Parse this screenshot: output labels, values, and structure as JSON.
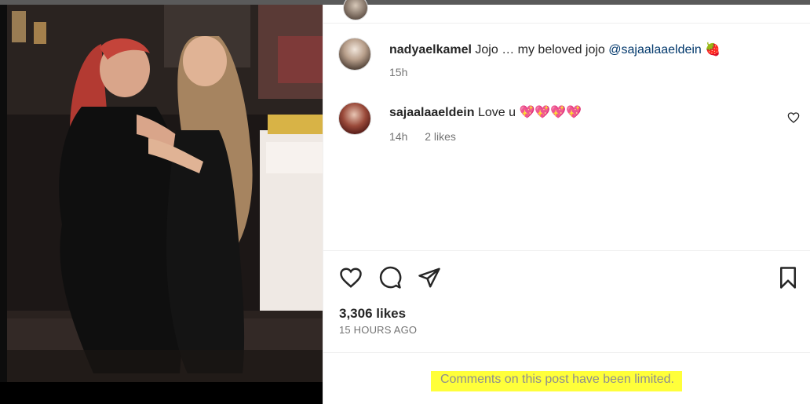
{
  "post": {
    "caption": {
      "username": "nadyaelkamel",
      "text": "Jojo … my beloved jojo",
      "mention": "@sajaalaaeldein",
      "emoji": "🍓",
      "time": "15h"
    },
    "comments": [
      {
        "username": "sajaalaaeldein",
        "text": "Love u",
        "emojis": "💖💖💖💖",
        "time": "14h",
        "likes": "2 likes"
      }
    ],
    "likes": "3,306 likes",
    "timestamp": "15 HOURS AGO",
    "comments_limited": "Comments on this post have been limited."
  },
  "icons": {
    "like": "heart-icon",
    "comment": "comment-bubble-icon",
    "share": "paper-plane-icon",
    "save": "bookmark-icon",
    "comment_like": "heart-outline-icon"
  },
  "colors": {
    "mention": "#00376b",
    "highlight": "#ffff3a",
    "muted": "#737373"
  }
}
